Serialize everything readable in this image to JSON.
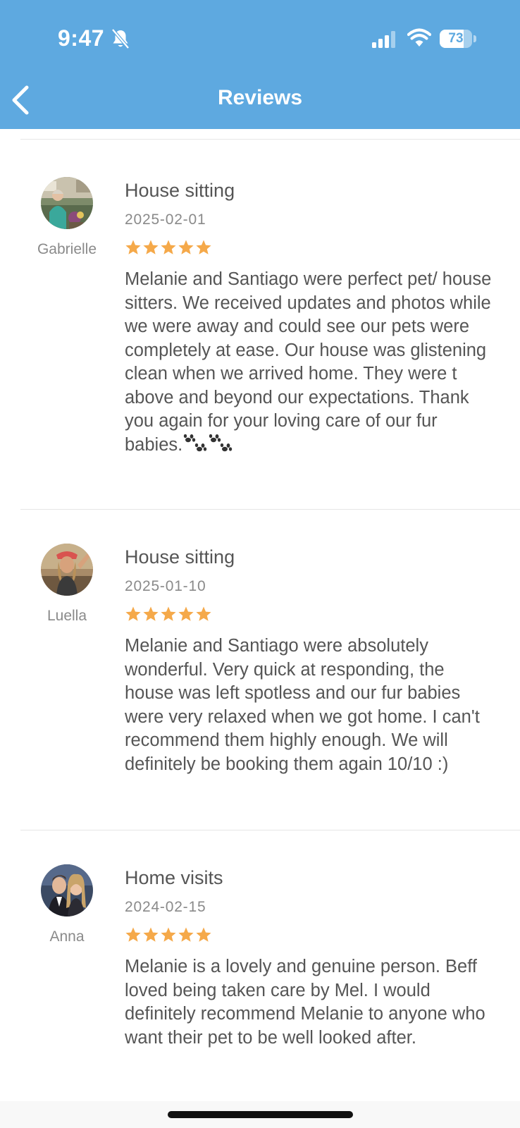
{
  "status_bar": {
    "time": "9:47",
    "battery_level": "73",
    "battery_fraction": 0.73
  },
  "nav": {
    "title": "Reviews",
    "back_icon": "chevron-left-icon"
  },
  "colors": {
    "header": "#5EA9E0",
    "star": "#F5A94A",
    "text": "#555555",
    "muted": "#8a8a8a"
  },
  "reviews": [
    {
      "reviewer": "Gabrielle",
      "service": "House sitting",
      "date": "2025-02-01",
      "rating": 5,
      "text": "Melanie and Santiago were perfect pet/ house sitters. We received updates and photos while we were away and could see our pets were completely at ease. Our house was glistening clean when we arrived home. They were t above and beyond our expectations. Thank you again for your loving care of our fur babies.",
      "trailing_icons": [
        "paw-prints-icon",
        "paw-prints-icon"
      ]
    },
    {
      "reviewer": "Luella",
      "service": "House sitting",
      "date": "2025-01-10",
      "rating": 5,
      "text": "Melanie and Santiago were absolutely wonderful. Very quick at responding, the house was left spotless and our fur babies were very relaxed when we got home. I can't recommend them highly enough. We will definitely be booking them again 10/10 :)"
    },
    {
      "reviewer": "Anna",
      "service": "Home visits",
      "date": "2024-02-15",
      "rating": 5,
      "text": "Melanie is a lovely and genuine person. Beff loved being taken care by Mel. I would definitely recommend Melanie to anyone who want their pet to be well looked after."
    }
  ]
}
